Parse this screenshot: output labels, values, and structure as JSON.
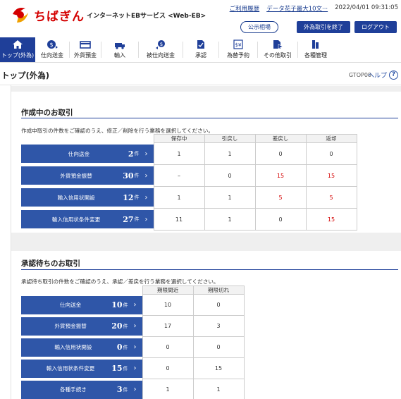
{
  "header": {
    "brand": "ちばぎん",
    "service": "インターネットEBサービス <Web-EB>",
    "history_link": "ご利用履歴",
    "user_name": "データ花子最大10文···",
    "datetime": "2022/04/01 09:31:05",
    "btn_rates": "公示相場",
    "btn_end_fx": "外為取引を終了",
    "btn_logout": "ログアウト",
    "brand_color": "#d40000",
    "accent": "#1f3f99"
  },
  "nav": [
    {
      "label": "トップ(外為)",
      "icon": "home-icon"
    },
    {
      "label": "仕向送金",
      "icon": "remit-icon"
    },
    {
      "label": "外貨預金",
      "icon": "deposit-icon"
    },
    {
      "label": "輸入",
      "icon": "import-icon"
    },
    {
      "label": "被仕向送金",
      "icon": "incoming-remit-icon"
    },
    {
      "label": "承認",
      "icon": "approve-icon"
    },
    {
      "label": "為替予約",
      "icon": "fx-contract-icon"
    },
    {
      "label": "その他取引",
      "icon": "other-icon"
    },
    {
      "label": "各種管理",
      "icon": "manage-icon"
    }
  ],
  "page": {
    "title": "トップ(外為)",
    "id": "GTOP00",
    "help": "ヘルプ",
    "help_mark": "?"
  },
  "drafting": {
    "title": "作成中のお取引",
    "desc": "作成中取引の件数をご確認のうえ、修正／削除を行う業務を選択してください。",
    "columns": [
      "保存中",
      "引戻し",
      "差戻し",
      "返却"
    ],
    "unit": "件",
    "rows": [
      {
        "label": "仕向送金",
        "count": "2",
        "cells": [
          "1",
          "1",
          "0",
          "0"
        ],
        "red": [
          false,
          false,
          false,
          false
        ]
      },
      {
        "label": "外貨預金振替",
        "count": "30",
        "cells": [
          "–",
          "0",
          "15",
          "15"
        ],
        "red": [
          false,
          false,
          true,
          true
        ]
      },
      {
        "label": "輸入信用状開設",
        "count": "12",
        "cells": [
          "1",
          "1",
          "5",
          "5"
        ],
        "red": [
          false,
          false,
          true,
          true
        ]
      },
      {
        "label": "輸入信用状条件変更",
        "count": "27",
        "cells": [
          "11",
          "1",
          "0",
          "15"
        ],
        "red": [
          false,
          false,
          false,
          true
        ]
      }
    ]
  },
  "approval": {
    "title": "承認待ちのお取引",
    "desc": "承認待ち取引の件数をご確認のうえ、承認／差戻を行う業務を選択してください。",
    "columns": [
      "期限間近",
      "期限切れ"
    ],
    "unit": "件",
    "rows": [
      {
        "label": "仕向送金",
        "count": "10",
        "cells": [
          "10",
          "0"
        ]
      },
      {
        "label": "外貨預金振替",
        "count": "20",
        "cells": [
          "17",
          "3"
        ]
      },
      {
        "label": "輸入信用状開設",
        "count": "0",
        "cells": [
          "0",
          "0"
        ]
      },
      {
        "label": "輸入信用状条件変更",
        "count": "15",
        "cells": [
          "0",
          "15"
        ]
      },
      {
        "label": "各種手続き",
        "count": "3",
        "cells": [
          "1",
          "1"
        ]
      }
    ]
  }
}
